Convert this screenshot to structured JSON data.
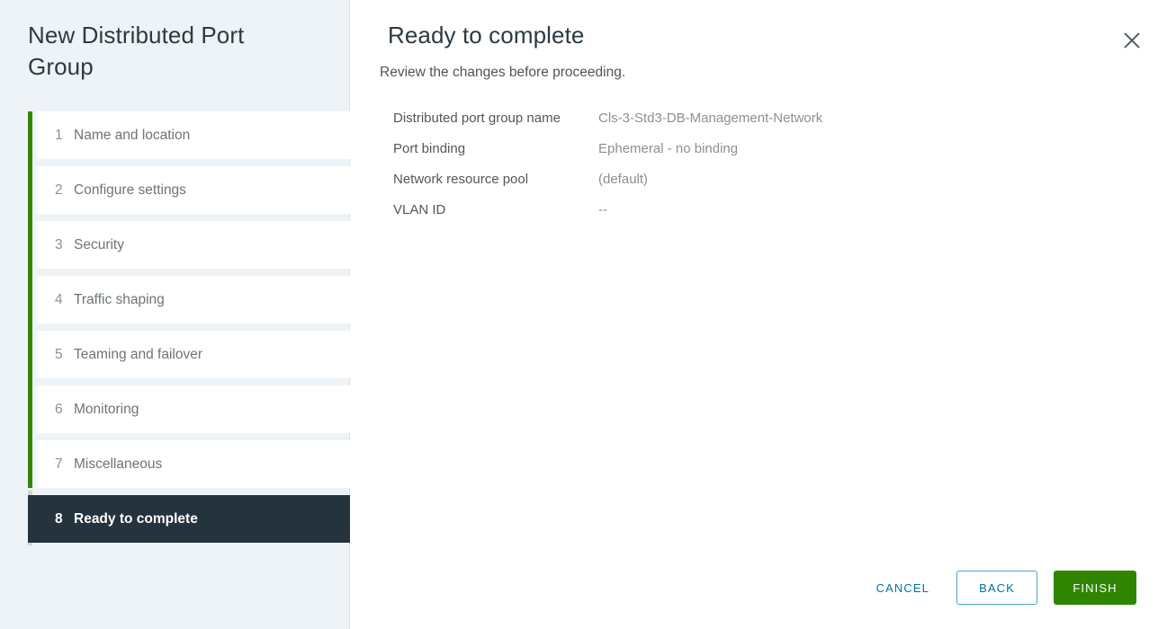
{
  "wizard": {
    "title": "New Distributed Port Group",
    "steps": [
      {
        "num": "1",
        "label": "Name and location",
        "state": "done"
      },
      {
        "num": "2",
        "label": "Configure settings",
        "state": "done"
      },
      {
        "num": "3",
        "label": "Security",
        "state": "done"
      },
      {
        "num": "4",
        "label": "Traffic shaping",
        "state": "done"
      },
      {
        "num": "5",
        "label": "Teaming and failover",
        "state": "done"
      },
      {
        "num": "6",
        "label": "Monitoring",
        "state": "done"
      },
      {
        "num": "7",
        "label": "Miscellaneous",
        "state": "done"
      },
      {
        "num": "8",
        "label": "Ready to complete",
        "state": "active"
      }
    ]
  },
  "content": {
    "title": "Ready to complete",
    "subtitle": "Review the changes before proceeding.",
    "close_icon": "close-icon",
    "summary": [
      {
        "label": "Distributed port group name",
        "value": "Cls-3-Std3-DB-Management-Network"
      },
      {
        "label": "Port binding",
        "value": "Ephemeral - no binding"
      },
      {
        "label": "Network resource pool",
        "value": "(default)"
      },
      {
        "label": "VLAN ID",
        "value": "--"
      }
    ]
  },
  "footer": {
    "cancel_label": "CANCEL",
    "back_label": "BACK",
    "finish_label": "FINISH"
  },
  "colors": {
    "accent_green": "#318700",
    "finish_green": "#2f8500",
    "link_blue": "#0072a3",
    "active_step_bg": "#25333d",
    "sidebar_bg": "#eef3f7"
  }
}
